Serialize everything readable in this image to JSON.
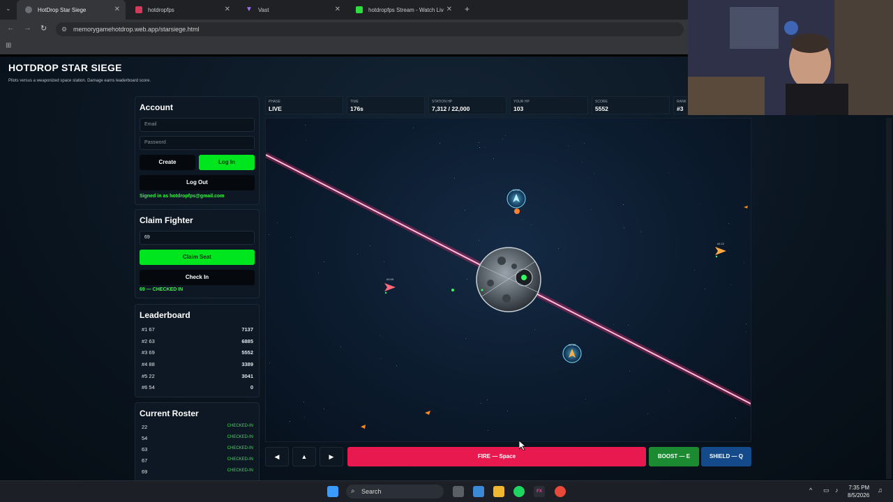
{
  "browser": {
    "tabs": [
      {
        "label": "HotDrop Star Siege",
        "favicon_color": "#6b6f75",
        "active": true
      },
      {
        "label": "hotdropfps",
        "favicon_color": "#d13a5a",
        "active": false
      },
      {
        "label": "Vast",
        "favicon_color": "#8a5ad8",
        "active": false
      },
      {
        "label": "hotdropfps Stream - Watch Liv",
        "favicon_color": "#2dde3d",
        "active": false
      }
    ],
    "url": "memorygamehotdrop.web.app/starsiege.html"
  },
  "site": {
    "title": "HOTDROP STAR SIEGE",
    "subtitle": "Pilots versus a weaponized space station. Damage earns leaderboard score."
  },
  "account": {
    "title": "Account",
    "email_placeholder": "Email",
    "password_placeholder": "Password",
    "create_label": "Create",
    "login_label": "Log In",
    "logout_label": "Log Out",
    "signed_in_text": "Signed in as hotdropfps@gmail.com"
  },
  "claim": {
    "title": "Claim Fighter",
    "seat_value": "69",
    "claim_label": "Claim Seat",
    "checkin_label": "Check In",
    "status_text": "69 — CHECKED IN"
  },
  "leaderboard": {
    "title": "Leaderboard",
    "rows": [
      {
        "rank": "#1 67",
        "score": "7137"
      },
      {
        "rank": "#2 63",
        "score": "6885"
      },
      {
        "rank": "#3 69",
        "score": "5552"
      },
      {
        "rank": "#4 88",
        "score": "3389"
      },
      {
        "rank": "#5 22",
        "score": "3041"
      },
      {
        "rank": "#6 54",
        "score": "0"
      }
    ]
  },
  "roster": {
    "title": "Current Roster",
    "rows": [
      {
        "id": "22",
        "status": "CHECKED-IN"
      },
      {
        "id": "54",
        "status": "CHECKED-IN"
      },
      {
        "id": "63",
        "status": "CHECKED-IN"
      },
      {
        "id": "67",
        "status": "CHECKED-IN"
      },
      {
        "id": "69",
        "status": "CHECKED-IN"
      }
    ]
  },
  "stats": [
    {
      "label": "PHASE",
      "value": "LIVE"
    },
    {
      "label": "TIME",
      "value": "176s"
    },
    {
      "label": "STATION HP",
      "value": "7,312 / 22,000"
    },
    {
      "label": "YOUR HP",
      "value": "103"
    },
    {
      "label": "SCORE",
      "value": "5552"
    },
    {
      "label": "RANK",
      "value": "#3"
    }
  ],
  "arena": {
    "ships": [
      {
        "label": "#1 67",
        "color": "#5ad8ff"
      },
      {
        "label": "#3 69",
        "color": "#ff6a7a"
      },
      {
        "label": "#5 22",
        "color": "#ffaa40"
      },
      {
        "label": "#2 63",
        "color": "#ffb040"
      }
    ],
    "laser_color": "#ff2a7a"
  },
  "controls": {
    "left_label": "◀",
    "up_label": "▲",
    "right_label": "▶",
    "fire_label": "FIRE — Space",
    "boost_label": "BOOST — E",
    "shield_label": "SHIELD — Q"
  },
  "taskbar": {
    "search_label": "Search",
    "time": "7:35 PM",
    "date": "8/5/2026"
  }
}
